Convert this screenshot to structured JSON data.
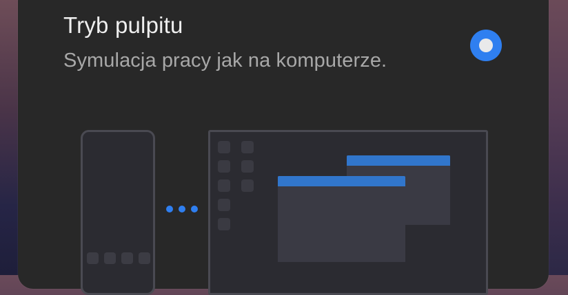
{
  "option": {
    "title": "Tryb pulpitu",
    "description": "Symulacja pracy jak na komputerze.",
    "selected": true
  },
  "colors": {
    "accent": "#2f7ff0",
    "card_background": "#282828",
    "title_text": "#efefef",
    "description_text": "#a8a8a8",
    "window_titlebar": "#3176cc"
  },
  "illustration": {
    "phone": "phone-outline-icon",
    "connection": "connection-dots-icon",
    "monitor": "desktop-monitor-icon"
  }
}
